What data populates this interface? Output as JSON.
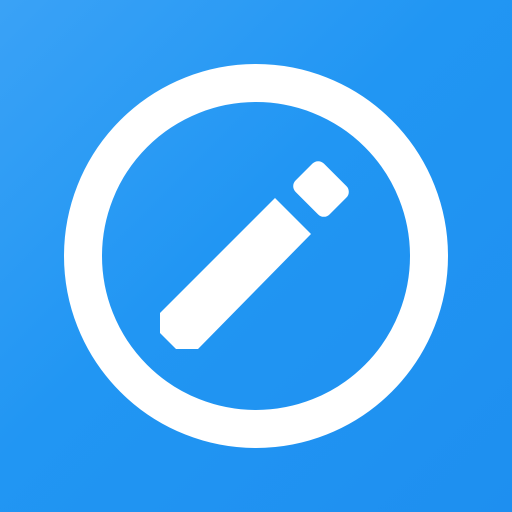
{
  "app_icon": {
    "icon": "edit-pencil-icon",
    "background_color": "#2196f3",
    "foreground_color": "#ffffff"
  }
}
